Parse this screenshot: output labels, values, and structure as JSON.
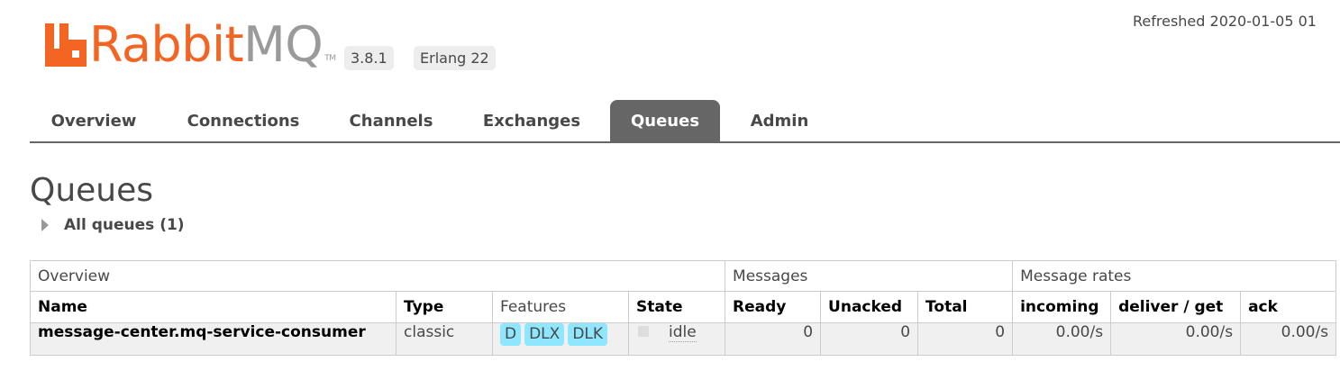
{
  "header": {
    "logo_rabbit": "Rabbit",
    "logo_mq": "MQ",
    "logo_tm": "TM",
    "version": "3.8.1",
    "erlang": "Erlang 22",
    "refreshed": "Refreshed 2020-01-05 01"
  },
  "nav": {
    "tabs": [
      {
        "label": "Overview",
        "active": false
      },
      {
        "label": "Connections",
        "active": false
      },
      {
        "label": "Channels",
        "active": false
      },
      {
        "label": "Exchanges",
        "active": false
      },
      {
        "label": "Queues",
        "active": true
      },
      {
        "label": "Admin",
        "active": false
      }
    ]
  },
  "main": {
    "title": "Queues",
    "section_label": "All queues (1)"
  },
  "table": {
    "groups": [
      "Overview",
      "Messages",
      "Message rates"
    ],
    "columns": [
      "Name",
      "Type",
      "Features",
      "State",
      "Ready",
      "Unacked",
      "Total",
      "incoming",
      "deliver / get",
      "ack"
    ],
    "rows": [
      {
        "name": "message-center.mq-service-consumer",
        "type": "classic",
        "features": [
          "D",
          "DLX",
          "DLK"
        ],
        "state": "idle",
        "ready": "0",
        "unacked": "0",
        "total": "0",
        "incoming": "0.00/s",
        "deliver_get": "0.00/s",
        "ack": "0.00/s"
      }
    ]
  },
  "colors": {
    "brand_orange": "#f26522",
    "brand_gray": "#9a9a9a",
    "tab_active_bg": "#666666",
    "feature_badge_bg": "#8ee6ff",
    "row_bg": "#f0f0f0"
  }
}
